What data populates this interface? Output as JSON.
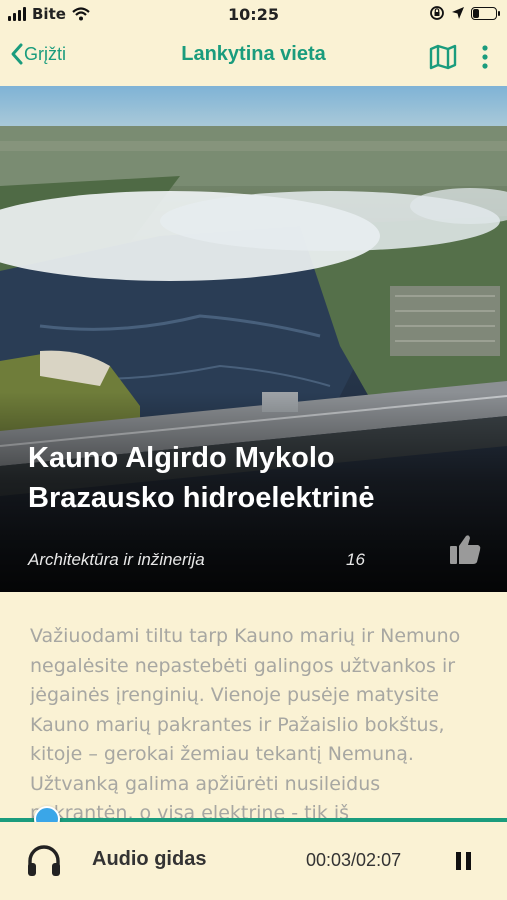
{
  "status_bar": {
    "carrier": "Bite",
    "time": "10:25",
    "battery_level": 0.3
  },
  "nav": {
    "back_label": "Grįžti",
    "title": "Lankytina vieta",
    "map_icon": "map-icon",
    "more_icon": "more-vertical-icon"
  },
  "hero": {
    "title": "Kauno Algirdo Mykolo Brazausko hidroelektrinė",
    "category": "Architektūra ir inžinerija",
    "like_count": "16",
    "like_icon": "thumbs-up-icon"
  },
  "description": "Važiuodami tiltu tarp Kauno marių ir Nemuno negalėsite nepastebėti galingos užtvankos ir jėgainės įrenginių. Vienoje pusėje matysite Kauno marių pakrantes ir Pažaislio bokštus, kitoje – gerokai žemiau tekantį Nemuną. Užtvanką galima apžiūrėti nusileidus pakrantėn, o visą elektrinę - tik iš",
  "player": {
    "label": "Audio gidas",
    "time": "00:03/02:07",
    "progress": 0.024,
    "icon": "headphones-icon",
    "control_icon": "pause-icon"
  },
  "colors": {
    "accent": "#1a9c7d",
    "background": "#faf2d4",
    "progress_thumb": "#3aa6e8"
  }
}
